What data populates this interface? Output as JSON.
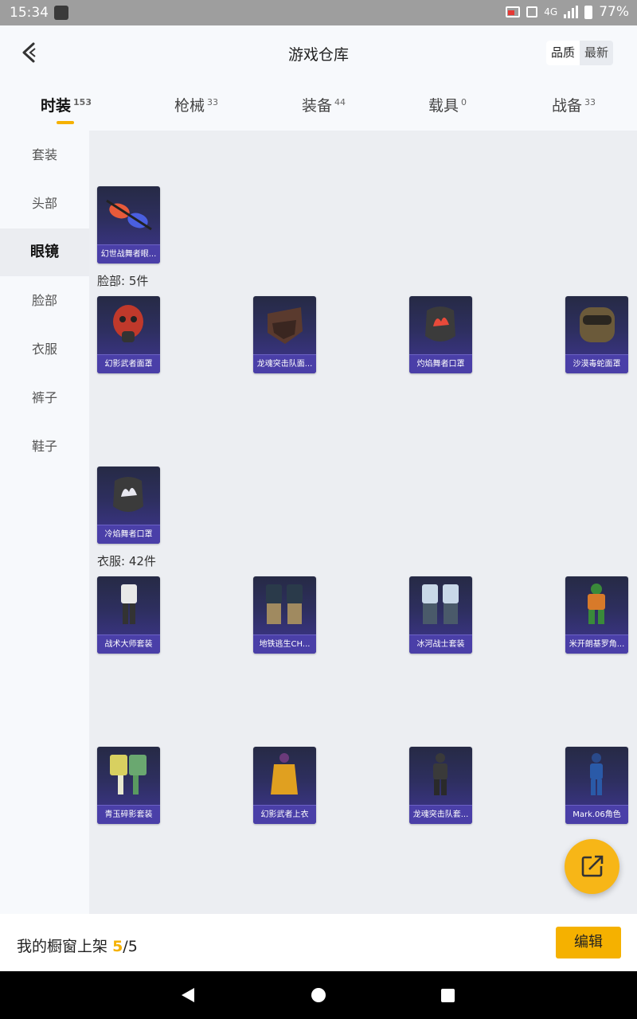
{
  "status_bar": {
    "time": "15:34",
    "network": "4G",
    "battery": "77%"
  },
  "header": {
    "title": "游戏仓库",
    "sort_options": [
      "品质",
      "最新"
    ]
  },
  "tabs": [
    {
      "label": "时装",
      "count": "153"
    },
    {
      "label": "枪械",
      "count": "33"
    },
    {
      "label": "装备",
      "count": "44"
    },
    {
      "label": "载具",
      "count": "0"
    },
    {
      "label": "战备",
      "count": "33"
    }
  ],
  "sidebar": [
    "套装",
    "头部",
    "眼镜",
    "脸部",
    "衣服",
    "裤子",
    "鞋子"
  ],
  "sections": {
    "face": "脸部: 5件",
    "clothes": "衣服: 42件"
  },
  "items": {
    "glasses": [
      "幻世战舞者眼..."
    ],
    "face": [
      "幻影武者面罩",
      "龙魂突击队面...",
      "灼焰舞者口罩",
      "沙漠毒蛇面罩",
      "冷焰舞者口罩"
    ],
    "clothes": [
      "战术大师套装",
      "地铁逃生CH...",
      "冰河战士套装",
      "米开朗基罗角...",
      "青玉碎影套装",
      "幻影武者上衣",
      "龙魂突击队套...",
      "Mark.06角色"
    ]
  },
  "bottom_bar": {
    "label": "我的橱窗上架",
    "count_current": "5",
    "count_total": "/5",
    "edit_button": "编辑"
  },
  "colors": {
    "accent": "#f5b100",
    "card_bg": "#2e2f60",
    "card_label": "#4a3fa8"
  },
  "icons": [
    "back-arrow-icon",
    "share-export-icon",
    "nav-back-icon",
    "nav-home-icon",
    "nav-recents-icon"
  ]
}
